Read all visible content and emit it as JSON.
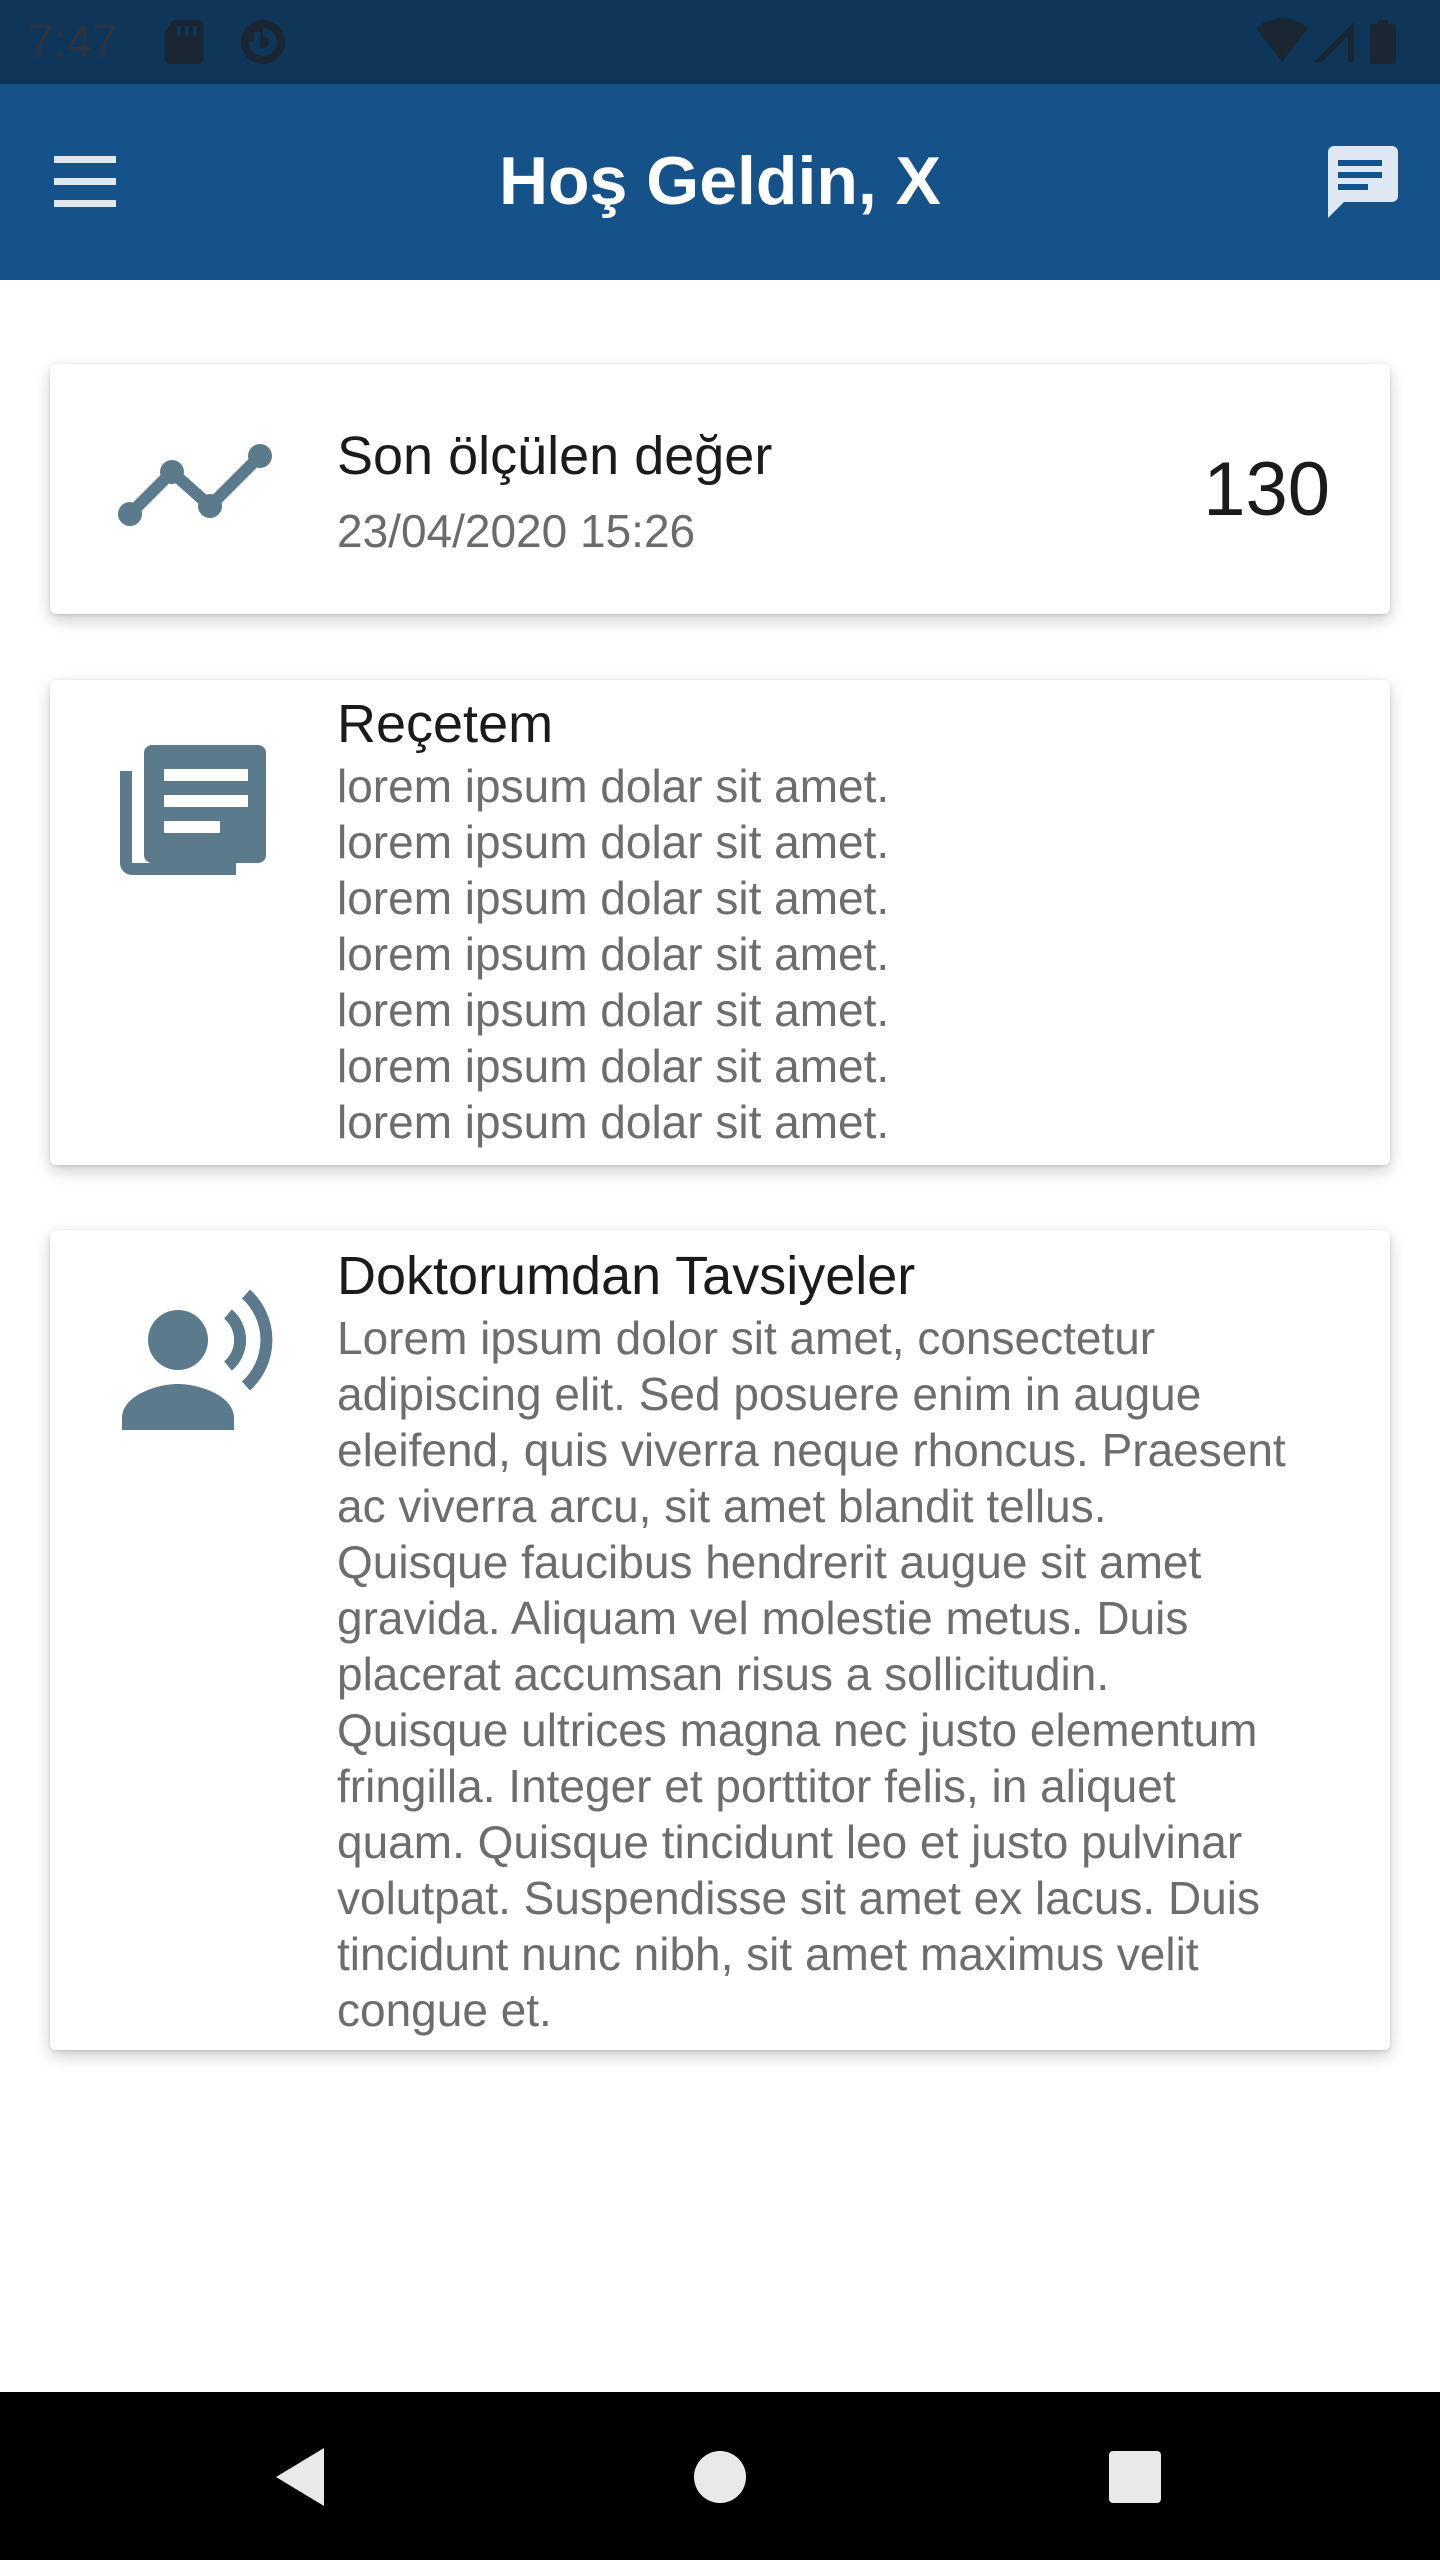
{
  "status_bar": {
    "time": "7:47",
    "left_icons": [
      "sd-card-icon",
      "data-saver-icon"
    ],
    "right_icons": [
      "wifi-icon",
      "cell-signal-icon",
      "battery-icon"
    ]
  },
  "app_bar": {
    "title": "Hoş Geldin, X",
    "menu_icon": "menu-icon",
    "chat_icon": "chat-icon"
  },
  "cards": {
    "measurement": {
      "icon": "trend-line-icon",
      "title": "Son ölçülen değer",
      "subtitle": "23/04/2020 15:26",
      "value": "130"
    },
    "prescription": {
      "icon": "prescription-document-icon",
      "title": "Reçetem",
      "body": "lorem ipsum dolar sit amet.\nlorem ipsum dolar sit amet.\nlorem ipsum dolar sit amet.\nlorem ipsum dolar sit amet.\nlorem ipsum dolar sit amet.\nlorem ipsum dolar sit amet.\nlorem ipsum dolar sit amet."
    },
    "doctor_advice": {
      "icon": "speaking-person-icon",
      "title": "Doktorumdan Tavsiyeler",
      "body": "Lorem ipsum dolor sit amet, consectetur\nadipiscing elit. Sed posuere enim in augue\neleifend, quis viverra neque rhoncus. Praesent\nac viverra arcu, sit amet blandit tellus.\nQuisque faucibus hendrerit augue sit amet\ngravida. Aliquam vel molestie metus. Duis\nplacerat accumsan risus a sollicitudin.\nQuisque ultrices magna nec justo elementum\nfringilla. Integer et porttitor felis, in aliquet\nquam. Quisque tincidunt leo et justo pulvinar\nvolutpat. Suspendisse sit amet ex lacus. Duis\ntincidunt nunc nibh, sit amet maximus velit\ncongue et."
    }
  },
  "nav_bar": {
    "buttons": [
      "back-icon",
      "home-icon",
      "recents-icon"
    ]
  },
  "colors": {
    "status_bar": "#0e3659",
    "app_bar": "#16528a",
    "icon_gray": "#5b7a8c",
    "nav_bar": "#000000"
  }
}
